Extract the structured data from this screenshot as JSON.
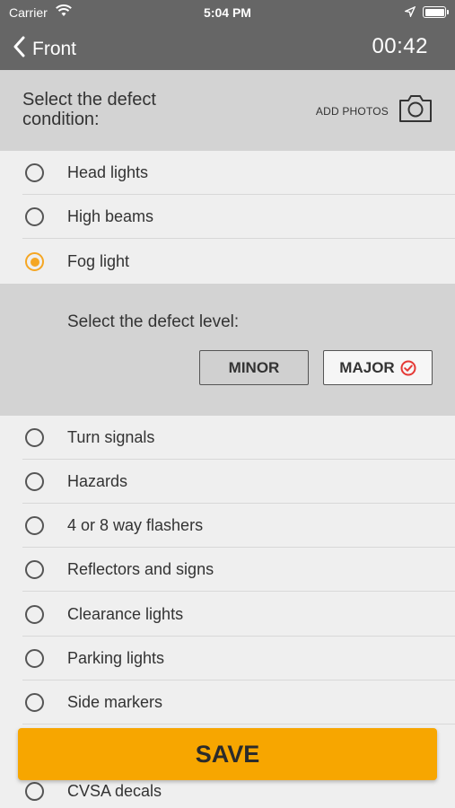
{
  "status_bar": {
    "carrier": "Carrier",
    "time": "5:04 PM"
  },
  "nav": {
    "back_label": "Front",
    "timer": "00:42"
  },
  "header": {
    "prompt": "Select the defect condition:",
    "add_photos": "ADD PHOTOS"
  },
  "items": [
    {
      "label": "Head lights",
      "selected": false
    },
    {
      "label": "High beams",
      "selected": false
    },
    {
      "label": "Fog light",
      "selected": true
    },
    {
      "label": "Turn signals",
      "selected": false
    },
    {
      "label": "Hazards",
      "selected": false
    },
    {
      "label": "4 or 8 way flashers",
      "selected": false
    },
    {
      "label": "Reflectors and signs",
      "selected": false
    },
    {
      "label": "Clearance lights",
      "selected": false
    },
    {
      "label": "Parking lights",
      "selected": false
    },
    {
      "label": "Side markers",
      "selected": false
    },
    {
      "label": "CVSA decals",
      "selected": false
    }
  ],
  "defect_level": {
    "title": "Select the defect level:",
    "minor_label": "MINOR",
    "major_label": "MAJOR",
    "selected": "MAJOR"
  },
  "save_label": "SAVE",
  "colors": {
    "accent": "#f7a600",
    "bar": "#666666",
    "panel": "#d3d3d3",
    "major_check": "#e53935"
  }
}
